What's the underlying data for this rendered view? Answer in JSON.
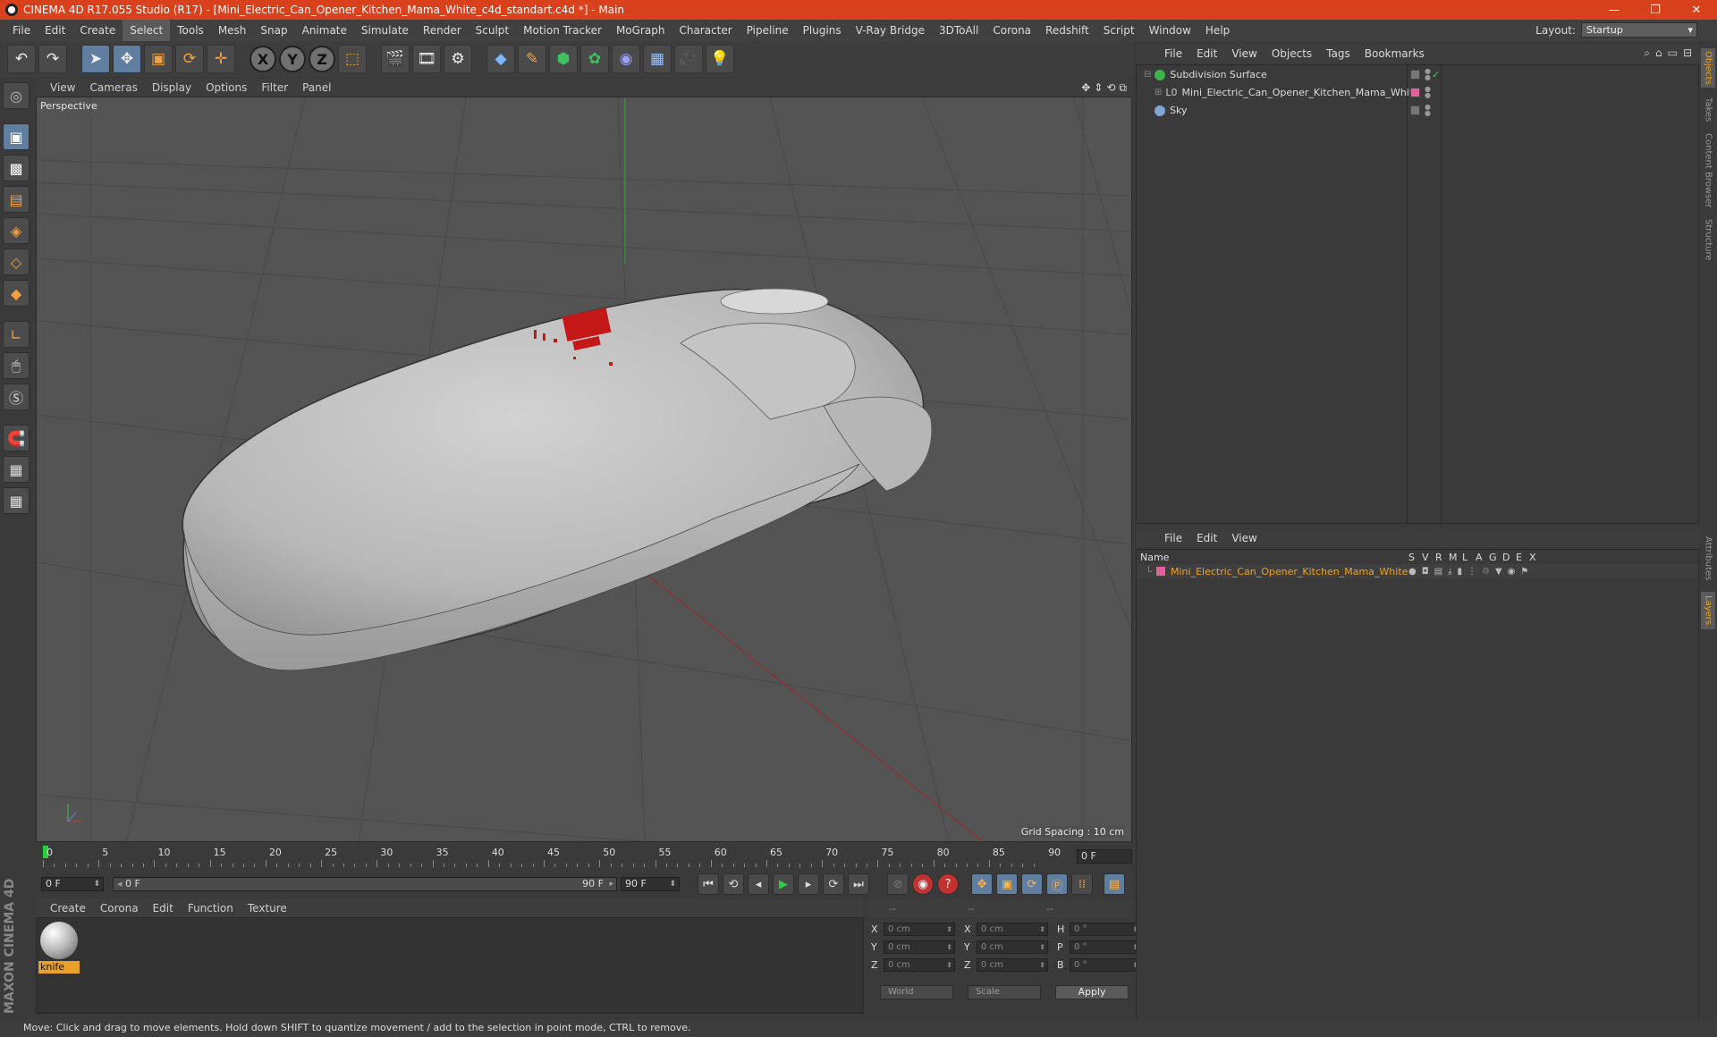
{
  "window": {
    "title": "CINEMA 4D R17.055 Studio (R17) - [Mini_Electric_Can_Opener_Kitchen_Mama_White_c4d_standart.c4d *] - Main"
  },
  "menubar": {
    "items": [
      "File",
      "Edit",
      "Create",
      "Select",
      "Tools",
      "Mesh",
      "Snap",
      "Animate",
      "Simulate",
      "Render",
      "Sculpt",
      "Motion Tracker",
      "MoGraph",
      "Character",
      "Pipeline",
      "Plugins",
      "V-Ray Bridge",
      "3DToAll",
      "Corona",
      "Redshift",
      "Script",
      "Window",
      "Help"
    ],
    "active": "Select",
    "layout_label": "Layout:",
    "layout_value": "Startup"
  },
  "viewport": {
    "menu": [
      "View",
      "Cameras",
      "Display",
      "Options",
      "Filter",
      "Panel"
    ],
    "camera_label": "Perspective",
    "grid_spacing": "Grid Spacing : 10 cm"
  },
  "timeline": {
    "ticks": [
      "0",
      "5",
      "10",
      "15",
      "20",
      "25",
      "30",
      "35",
      "40",
      "45",
      "50",
      "55",
      "60",
      "65",
      "70",
      "75",
      "80",
      "85",
      "90"
    ],
    "current_frame": "0 F",
    "start_field": "0 F",
    "range_start": "0 F",
    "range_end": "90 F",
    "end_field": "90 F"
  },
  "material_manager": {
    "menu": [
      "Create",
      "Corona",
      "Edit",
      "Function",
      "Texture"
    ],
    "material_name": "knife"
  },
  "coordinates": {
    "headers": [
      "--",
      "--",
      "--"
    ],
    "rows": [
      {
        "axis": "X",
        "pos": "0 cm",
        "size_axis": "X",
        "size": "0 cm",
        "rot_axis": "H",
        "rot": "0 °"
      },
      {
        "axis": "Y",
        "pos": "0 cm",
        "size_axis": "Y",
        "size": "0 cm",
        "rot_axis": "P",
        "rot": "0 °"
      },
      {
        "axis": "Z",
        "pos": "0 cm",
        "size_axis": "Z",
        "size": "0 cm",
        "rot_axis": "B",
        "rot": "0 °"
      }
    ],
    "mode": "World",
    "size_mode": "Scale",
    "apply": "Apply"
  },
  "object_manager": {
    "menu": [
      "File",
      "Edit",
      "View",
      "Objects",
      "Tags",
      "Bookmarks"
    ],
    "objects": [
      {
        "name": "Subdivision Surface",
        "color": "#3fb24a"
      },
      {
        "name": "Mini_Electric_Can_Opener_Kitchen_Mama_White",
        "color": "#cccccc"
      },
      {
        "name": "Sky",
        "color": "#7fa7d6"
      }
    ]
  },
  "layer_manager": {
    "menu": [
      "File",
      "Edit",
      "View"
    ],
    "columns": [
      "Name",
      "S",
      "V",
      "R",
      "M",
      "L",
      "A",
      "G",
      "D",
      "E",
      "X"
    ],
    "layer_name": "Mini_Electric_Can_Opener_Kitchen_Mama_White",
    "layer_color": "#e0609a"
  },
  "right_tabs": [
    "Objects",
    "Takes",
    "Content Browser",
    "Structure",
    "Attributes",
    "Layers"
  ],
  "status": "Move: Click and drag to move elements. Hold down SHIFT to quantize movement / add to the selection in point mode, CTRL to remove.",
  "brand": "MAXON CINEMA 4D"
}
